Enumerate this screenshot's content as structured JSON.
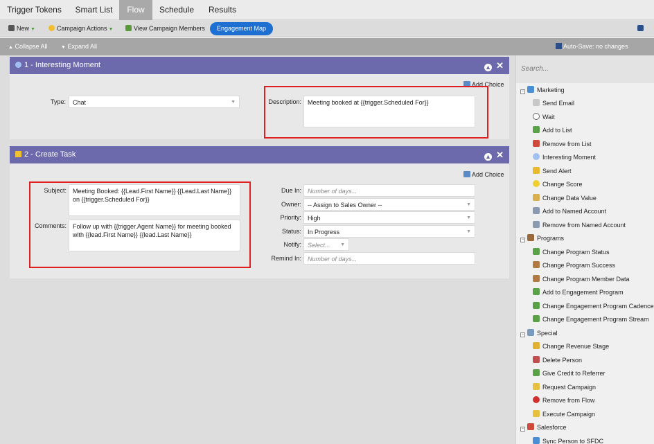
{
  "tabs": [
    {
      "label": "Trigger Tokens",
      "active": false
    },
    {
      "label": "Smart List",
      "active": false
    },
    {
      "label": "Flow",
      "active": true
    },
    {
      "label": "Schedule",
      "active": false
    },
    {
      "label": "Results",
      "active": false
    }
  ],
  "toolbar": {
    "new_label": "New",
    "campaign_actions_label": "Campaign Actions",
    "view_members_label": "View Campaign Members",
    "engagement_map_label": "Engagement Map"
  },
  "subbar": {
    "collapse_label": "Collapse All",
    "expand_label": "Expand All",
    "autosave_label": "Auto-Save: no changes"
  },
  "step1": {
    "title": "1 - Interesting Moment",
    "add_choice": "Add Choice",
    "type_label": "Type:",
    "type_value": "Chat",
    "description_label": "Description:",
    "description_value": "Meeting booked at {{trigger.Scheduled For}}"
  },
  "step2": {
    "title": "2 - Create Task",
    "add_choice": "Add Choice",
    "subject_label": "Subject:",
    "subject_value": "Meeting Booked: {{Lead.First Name}} {{Lead.Last Name}} on {{trigger.Scheduled For}}",
    "comments_label": "Comments:",
    "comments_value": "Follow up with {{trigger.Agent Name}} for meeting booked with {{lead.First Name}} {{lead.Last Name}}",
    "due_in_label": "Due In:",
    "due_in_placeholder": "Number of days...",
    "owner_label": "Owner:",
    "owner_value": "-- Assign to Sales Owner --",
    "priority_label": "Priority:",
    "priority_value": "High",
    "status_label": "Status:",
    "status_value": "In Progress",
    "notify_label": "Notify:",
    "notify_placeholder": "Select...",
    "remind_in_label": "Remind In:",
    "remind_in_placeholder": "Number of days..."
  },
  "sidebar": {
    "search_placeholder": "Search...",
    "groups": [
      {
        "label": "Marketing",
        "items": [
          "Send Email",
          "Wait",
          "Add to List",
          "Remove from List",
          "Interesting Moment",
          "Send Alert",
          "Change Score",
          "Change Data Value",
          "Add to Named Account",
          "Remove from Named Account"
        ]
      },
      {
        "label": "Programs",
        "items": [
          "Change Program Status",
          "Change Program Success",
          "Change Program Member Data",
          "Add to Engagement Program",
          "Change Engagement Program Cadence",
          "Change Engagement Program Stream"
        ]
      },
      {
        "label": "Special",
        "items": [
          "Change Revenue Stage",
          "Delete Person",
          "Give Credit to Referrer",
          "Request Campaign",
          "Remove from Flow",
          "Execute Campaign"
        ]
      },
      {
        "label": "Salesforce",
        "items": [
          "Sync Person to SFDC"
        ]
      }
    ]
  },
  "colors": {
    "header_purple": "#6d69ad",
    "accent_blue": "#1d6fd1",
    "highlight_red": "#e02020"
  }
}
